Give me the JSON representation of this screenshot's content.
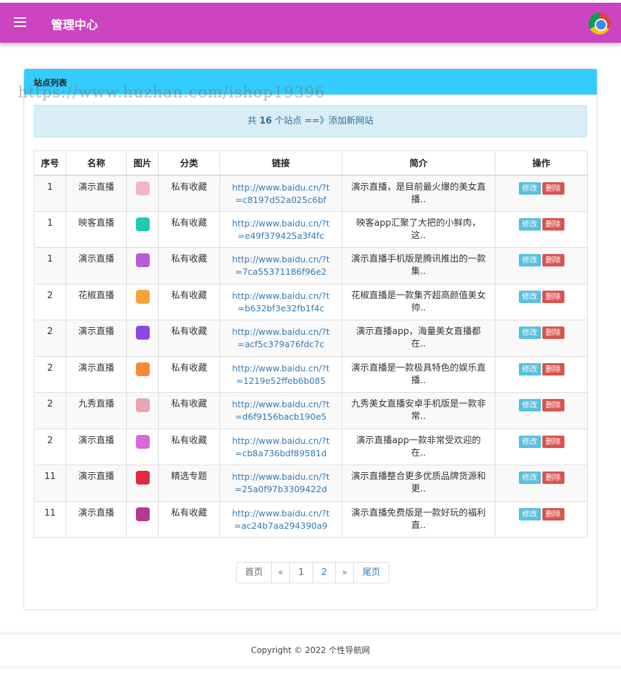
{
  "header": {
    "title": "管理中心",
    "menu_icon": "hamburger-menu-icon",
    "browser_icon": "chrome-icon"
  },
  "panel": {
    "title": "站点列表",
    "watermark": "https://www.huzhan.com/ishop19396",
    "alert": {
      "prefix": "共 ",
      "count": "16",
      "suffix": " 个站点 ==》",
      "link": "添加新网站"
    }
  },
  "table": {
    "headers": [
      "序号",
      "名称",
      "图片",
      "分类",
      "链接",
      "简介",
      "操作"
    ],
    "edit_label": "修改",
    "delete_label": "删除",
    "rows": [
      {
        "no": "1",
        "name": "演示直播",
        "category": "私有收藏",
        "link": "http://www.baidu.cn/?t=c8197d52a025c6bf",
        "intro": "演示直播，是目前最火爆的美女直播..",
        "thumb": "#f3b6c8"
      },
      {
        "no": "1",
        "name": "映客直播",
        "category": "私有收藏",
        "link": "http://www.baidu.cn/?t=e49f379425a3f4fc",
        "intro": "映客app汇聚了大把的小鲜肉，这..",
        "thumb": "#23c9b5"
      },
      {
        "no": "1",
        "name": "演示直播",
        "category": "私有收藏",
        "link": "http://www.baidu.cn/?t=7ca55371186f96e2",
        "intro": "演示直播手机版是腾讯推出的一款集..",
        "thumb": "#b45bd6"
      },
      {
        "no": "2",
        "name": "花椒直播",
        "category": "私有收藏",
        "link": "http://www.baidu.cn/?t=b632bf3e32fb1f4c",
        "intro": "花椒直播是一款集齐超高颜值美女帅..",
        "thumb": "#f7a23a"
      },
      {
        "no": "2",
        "name": "演示直播",
        "category": "私有收藏",
        "link": "http://www.baidu.cn/?t=acf5c379a76fdc7c",
        "intro": "演示直播app，海量美女直播都在..",
        "thumb": "#8b46e8"
      },
      {
        "no": "2",
        "name": "演示直播",
        "category": "私有收藏",
        "link": "http://www.baidu.cn/?t=1219e52ffeb6b085",
        "intro": "演示直播是一款极具特色的娱乐直播..",
        "thumb": "#f58a3a"
      },
      {
        "no": "2",
        "name": "九秀直播",
        "category": "私有收藏",
        "link": "http://www.baidu.cn/?t=d6f9156bacb190e5",
        "intro": "九秀美女直播安卓手机版是一款非常..",
        "thumb": "#e8a6b4"
      },
      {
        "no": "2",
        "name": "演示直播",
        "category": "私有收藏",
        "link": "http://www.baidu.cn/?t=cb8a736bdf89581d",
        "intro": "演示直播app一款非常受欢迎的在..",
        "thumb": "#d86ad8"
      },
      {
        "no": "11",
        "name": "演示直播",
        "category": "精选专题",
        "link": "http://www.baidu.cn/?t=25a0f97b3309422d",
        "intro": "演示直播整合更多优质品牌货源和更..",
        "thumb": "#e0283f"
      },
      {
        "no": "11",
        "name": "演示直播",
        "category": "私有收藏",
        "link": "http://www.baidu.cn/?t=ac24b7aa294390a9",
        "intro": "演示直播免费版是一款好玩的福利直..",
        "thumb": "#b7368f"
      }
    ]
  },
  "pagination": {
    "first": "首页",
    "prev": "«",
    "pages": [
      "1",
      "2"
    ],
    "next": "»",
    "last": "尾页"
  },
  "footer": {
    "copyright": "Copyright © 2022 个性导航网"
  }
}
